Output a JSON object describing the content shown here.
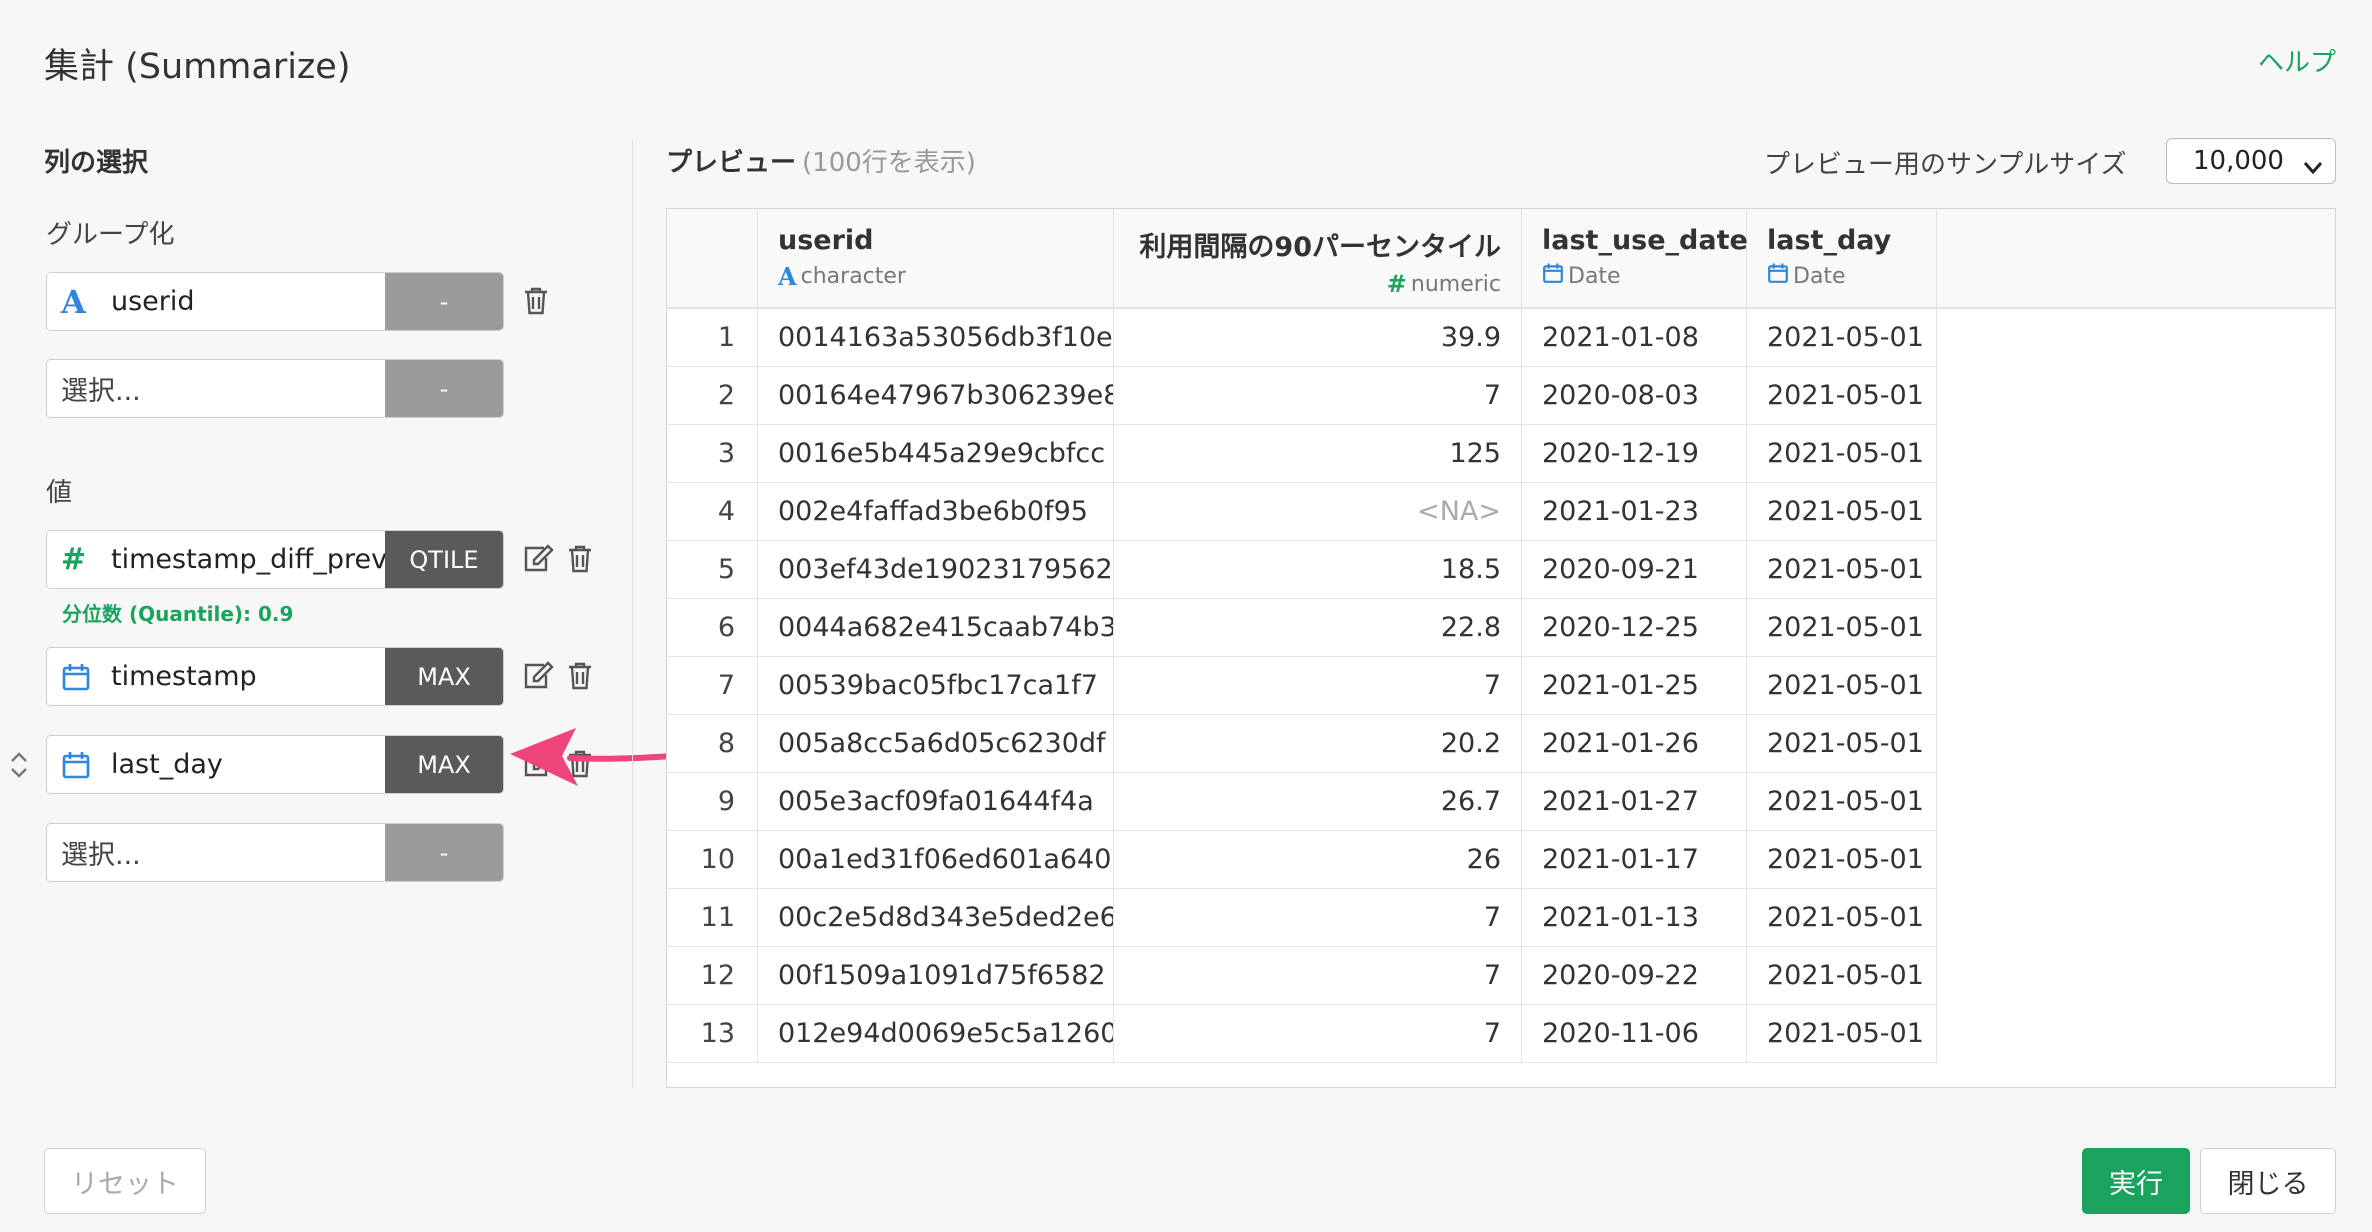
{
  "header": {
    "title": "集計 (Summarize)",
    "help": "ヘルプ"
  },
  "left": {
    "section_title": "列の選択",
    "group_label": "グループ化",
    "group_fields": [
      {
        "icon": "character-icon",
        "name": "userid",
        "agg": "-"
      },
      {
        "placeholder": "選択...",
        "agg": "-"
      }
    ],
    "value_label": "値",
    "value_fields": [
      {
        "icon": "numeric-icon",
        "name": "timestamp_diff_prev",
        "agg": "QTILE",
        "note": "分位数 (Quantile): 0.9"
      },
      {
        "icon": "calendar-icon",
        "name": "timestamp",
        "agg": "MAX"
      },
      {
        "icon": "calendar-icon",
        "name": "last_day",
        "agg": "MAX"
      },
      {
        "placeholder": "選択...",
        "agg": "-"
      }
    ]
  },
  "preview": {
    "title": "プレビュー",
    "count": "(100行を表示)",
    "sample_label": "プレビュー用のサンプルサイズ",
    "sample_value": "10,000",
    "columns": [
      {
        "name": "userid",
        "type": "character",
        "type_icon": "character-icon"
      },
      {
        "name": "利用間隔の90パーセンタイル",
        "type": "numeric",
        "type_icon": "numeric-icon"
      },
      {
        "name": "last_use_date",
        "type": "Date",
        "type_icon": "calendar-icon"
      },
      {
        "name": "last_day",
        "type": "Date",
        "type_icon": "calendar-icon"
      }
    ],
    "rows": [
      [
        "1",
        "0014163a53056db3f10e",
        "39.9",
        "2021-01-08",
        "2021-05-01"
      ],
      [
        "2",
        "00164e47967b306239e8",
        "7",
        "2020-08-03",
        "2021-05-01"
      ],
      [
        "3",
        "0016e5b445a29e9cbfcc",
        "125",
        "2020-12-19",
        "2021-05-01"
      ],
      [
        "4",
        "002e4faffad3be6b0f95",
        "<NA>",
        "2021-01-23",
        "2021-05-01"
      ],
      [
        "5",
        "003ef43de19023179562",
        "18.5",
        "2020-09-21",
        "2021-05-01"
      ],
      [
        "6",
        "0044a682e415caab74b3",
        "22.8",
        "2020-12-25",
        "2021-05-01"
      ],
      [
        "7",
        "00539bac05fbc17ca1f7",
        "7",
        "2021-01-25",
        "2021-05-01"
      ],
      [
        "8",
        "005a8cc5a6d05c6230df",
        "20.2",
        "2021-01-26",
        "2021-05-01"
      ],
      [
        "9",
        "005e3acf09fa01644f4a",
        "26.7",
        "2021-01-27",
        "2021-05-01"
      ],
      [
        "10",
        "00a1ed31f06ed601a640",
        "26",
        "2021-01-17",
        "2021-05-01"
      ],
      [
        "11",
        "00c2e5d8d343e5ded2e6",
        "7",
        "2021-01-13",
        "2021-05-01"
      ],
      [
        "12",
        "00f1509a1091d75f6582",
        "7",
        "2020-09-22",
        "2021-05-01"
      ],
      [
        "13",
        "012e94d0069e5c5a1260",
        "7",
        "2020-11-06",
        "2021-05-01"
      ]
    ]
  },
  "footer": {
    "reset": "リセット",
    "run": "実行",
    "close": "閉じる"
  },
  "colors": {
    "accent": "#1aa35e",
    "char_blue": "#2e86de",
    "arrow": "#f0457a"
  }
}
